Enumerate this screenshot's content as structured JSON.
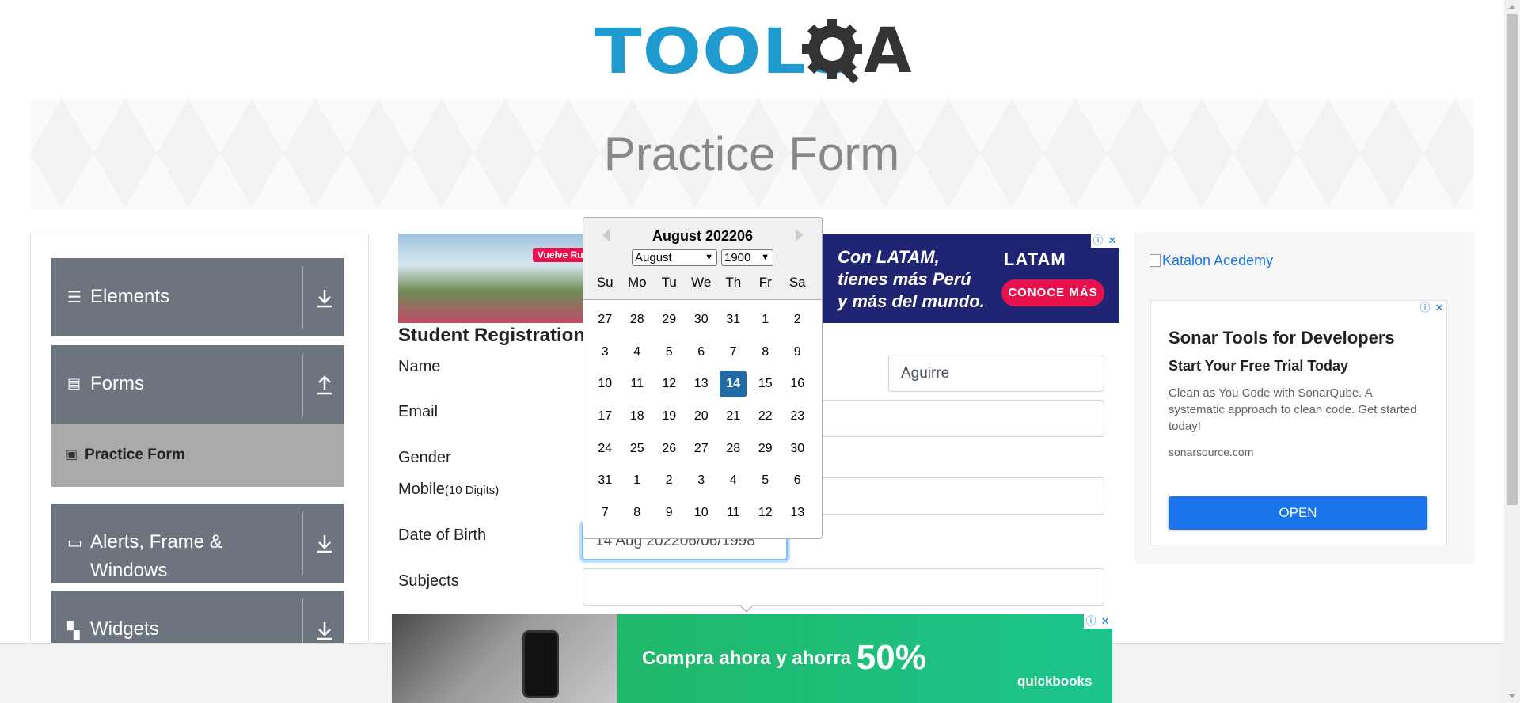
{
  "header": {
    "logo_text": "TOOLS",
    "logo_accent": "A",
    "brand_blue": "#1f9bcf"
  },
  "banner": {
    "title": "Practice Form"
  },
  "sidebar": {
    "groups": [
      {
        "label": "Elements",
        "icon": "hamburger-icon",
        "arrow": "download-icon"
      },
      {
        "label": "Forms",
        "icon": "document-icon",
        "arrow": "upload-icon"
      },
      {
        "label": "Alerts, Frame &",
        "label2": "Windows",
        "icon": "window-icon",
        "arrow": "download-icon"
      },
      {
        "label": "Widgets",
        "icon": "widget-icon",
        "arrow": "download-icon"
      }
    ],
    "active_item": {
      "label": "Practice Form",
      "icon": "form-icon"
    }
  },
  "ads": {
    "top": {
      "tag": "Vuelve Rut",
      "headline_line1": "Con LATAM,",
      "headline_line2": "tienes más Perú",
      "headline_line3": "y más del mundo.",
      "brand": "LATAM",
      "button": "CONOCE MÁS"
    },
    "side": {
      "katalon_alt": "Katalon Acedemy",
      "title": "Sonar Tools for Developers",
      "subtitle": "Start Your Free Trial Today",
      "description": "Clean as You Code with SonarQube. A systematic approach to clean code. Get started today!",
      "url": "sonarsource.com",
      "button": "OPEN"
    },
    "bottom": {
      "text": "Compra ahora y ahorra",
      "percent": "50%",
      "brand": "quickbooks"
    },
    "choice_info": "ⓘ",
    "choice_close": "✕"
  },
  "form": {
    "title": "Student Registration",
    "labels": {
      "name": "Name",
      "email": "Email",
      "gender": "Gender",
      "mobile": "Mobile",
      "mobile_hint": "(10 Digits)",
      "dob": "Date of Birth",
      "subjects": "Subjects"
    },
    "last_name_value": "Aguirre",
    "dob_value": "14 Aug 202206/06/1998"
  },
  "datepicker": {
    "header": "August 202206",
    "month_select": "August",
    "year_select": "1900",
    "weekdays": [
      "Su",
      "Mo",
      "Tu",
      "We",
      "Th",
      "Fr",
      "Sa"
    ],
    "weeks": [
      [
        "27",
        "28",
        "29",
        "30",
        "31",
        "1",
        "2"
      ],
      [
        "3",
        "4",
        "5",
        "6",
        "7",
        "8",
        "9"
      ],
      [
        "10",
        "11",
        "12",
        "13",
        "14",
        "15",
        "16"
      ],
      [
        "17",
        "18",
        "19",
        "20",
        "21",
        "22",
        "23"
      ],
      [
        "24",
        "25",
        "26",
        "27",
        "28",
        "29",
        "30"
      ],
      [
        "31",
        "1",
        "2",
        "3",
        "4",
        "5",
        "6"
      ],
      [
        "7",
        "8",
        "9",
        "10",
        "11",
        "12",
        "13"
      ]
    ],
    "selected_day": "14",
    "selected_color": "#216ba5"
  }
}
